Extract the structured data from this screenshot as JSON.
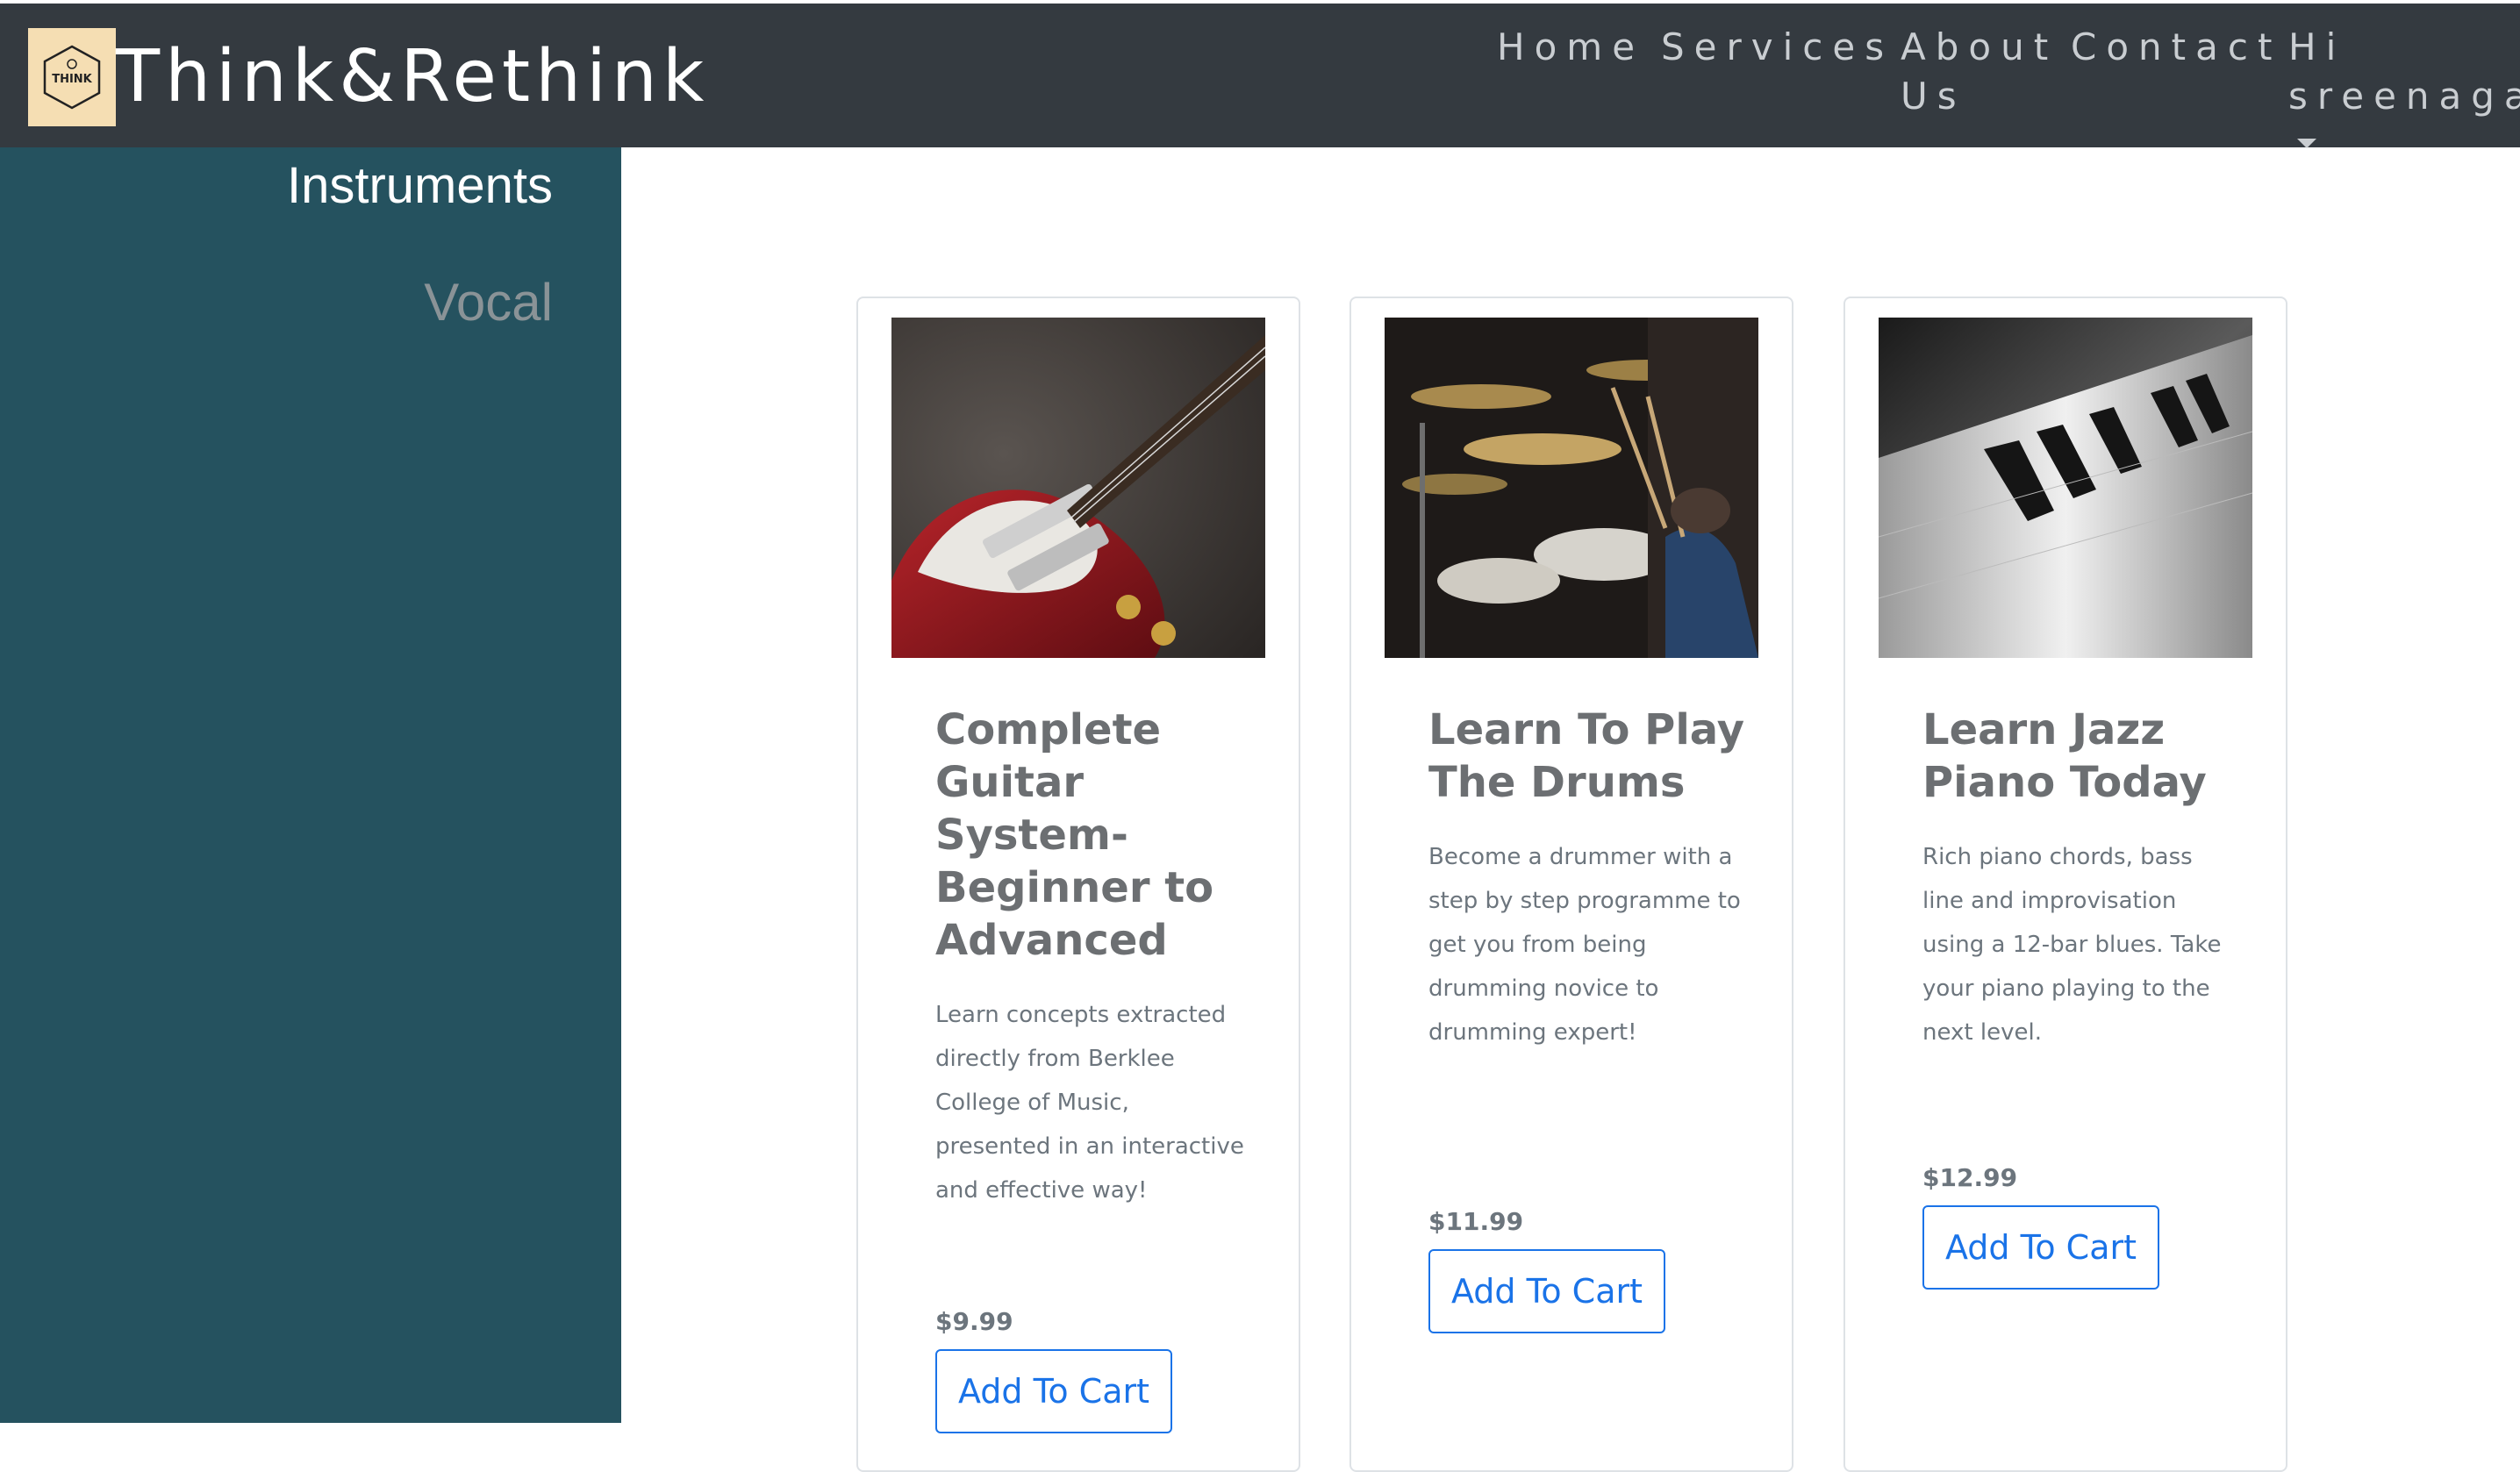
{
  "header": {
    "brand": "Think&Rethink",
    "logo_text": "THINK",
    "nav": {
      "home": "Home",
      "services": "Services",
      "about": "About\nUs",
      "contact": "Contact",
      "user": "Hi\nsreenagas"
    }
  },
  "sidebar": {
    "items": [
      {
        "label": "Instruments",
        "active": true
      },
      {
        "label": "Vocal",
        "active": false
      }
    ]
  },
  "courses": [
    {
      "title": "Complete Guitar System- Beginner to Advanced",
      "description": "Learn concepts extracted directly from Berklee College of Music, presented in an interactive and effective way!",
      "price": "$9.99",
      "button": "Add To Cart",
      "image_icon": "guitar-image"
    },
    {
      "title": "Learn To Play The Drums",
      "description": "Become a drummer with a step by step programme to get you from being drumming novice to drumming expert!",
      "price": "$11.99",
      "button": "Add To Cart",
      "image_icon": "drums-image"
    },
    {
      "title": "Learn Jazz Piano Today",
      "description": "Rich piano chords, bass line and improvisation using a 12-bar blues. Take your piano playing to the next level.",
      "price": "$12.99",
      "button": "Add To Cart",
      "image_icon": "piano-image"
    }
  ],
  "colors": {
    "navbar": "#343a40",
    "sidebar": "#25525f",
    "accent": "#1a73e8",
    "logo_bg": "#f5deb3"
  }
}
